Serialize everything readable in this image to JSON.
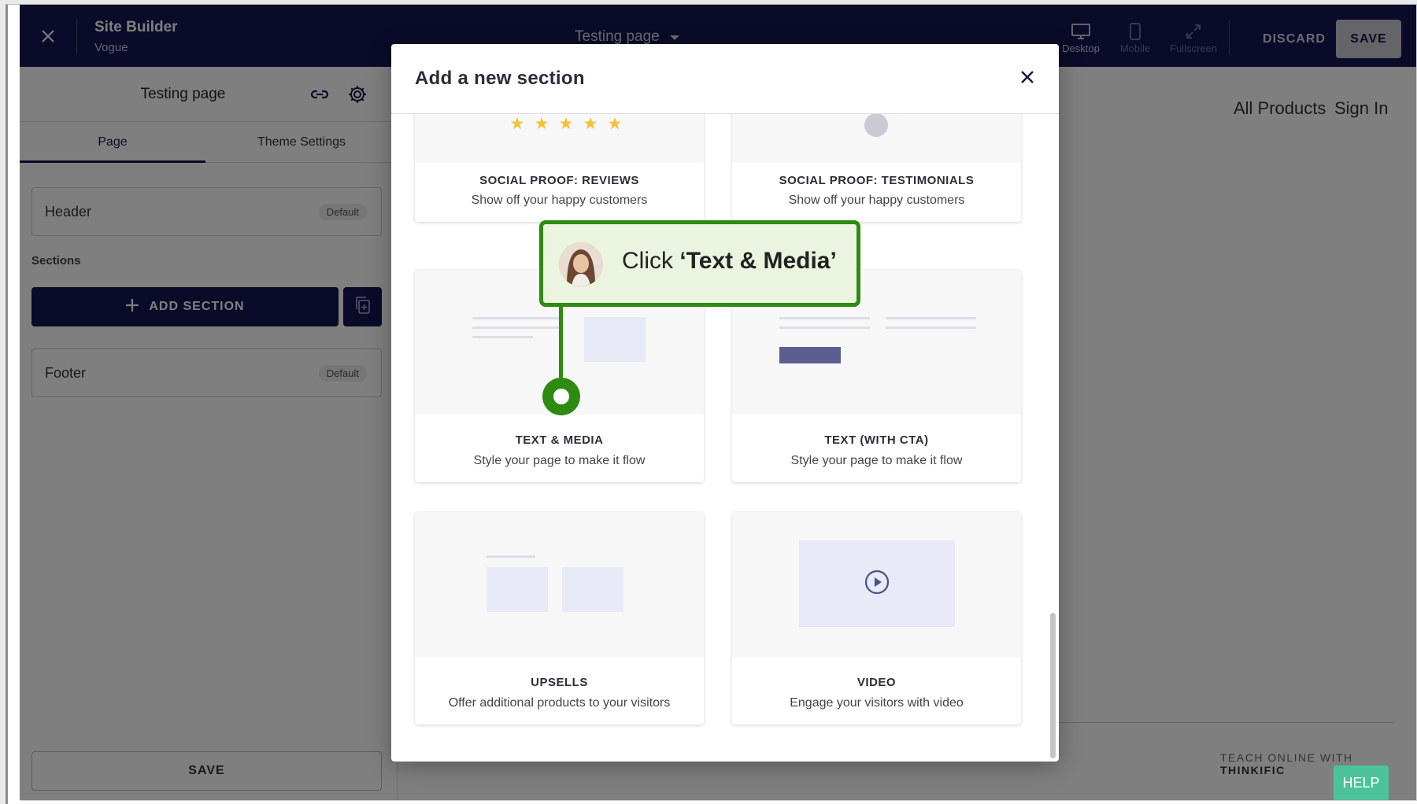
{
  "topbar": {
    "title": "Site Builder",
    "subtitle": "Vogue",
    "page_selector": "Testing page",
    "views": [
      {
        "label": "Desktop",
        "icon": "desktop-icon"
      },
      {
        "label": "Mobile",
        "icon": "mobile-icon"
      },
      {
        "label": "Fullscreen",
        "icon": "fullscreen-icon"
      }
    ],
    "discard_label": "DISCARD",
    "save_label": "SAVE"
  },
  "sidebar": {
    "title": "Testing page",
    "tabs": [
      "Page",
      "Theme Settings"
    ],
    "header_card": {
      "label": "Header",
      "badge": "Default"
    },
    "sections_label": "Sections",
    "add_section_label": "ADD SECTION",
    "footer_card": {
      "label": "Footer",
      "badge": "Default"
    },
    "save_label": "SAVE"
  },
  "preview": {
    "nav": [
      "All Products",
      "Sign In"
    ],
    "footer_prefix": "TEACH ONLINE WITH",
    "footer_brand": "THINKIFIC"
  },
  "modal": {
    "title": "Add a new section",
    "cards": [
      {
        "title": "SOCIAL PROOF: REVIEWS",
        "desc": "Show off your happy customers"
      },
      {
        "title": "SOCIAL PROOF: TESTIMONIALS",
        "desc": "Show off your happy customers"
      },
      {
        "title": "TEXT & MEDIA",
        "desc": "Style your page to make it flow"
      },
      {
        "title": "TEXT (WITH CTA)",
        "desc": "Style your page to make it flow"
      },
      {
        "title": "UPSELLS",
        "desc": "Offer additional products to your visitors"
      },
      {
        "title": "VIDEO",
        "desc": "Engage your visitors with video"
      }
    ]
  },
  "callout": {
    "prefix": "Click ",
    "target": "‘Text & Media’"
  },
  "help_label": "HELP",
  "colors": {
    "navy": "#141650",
    "callout_green": "#2f8a12",
    "help_green": "#4cc29a",
    "star": "#f2c230"
  }
}
